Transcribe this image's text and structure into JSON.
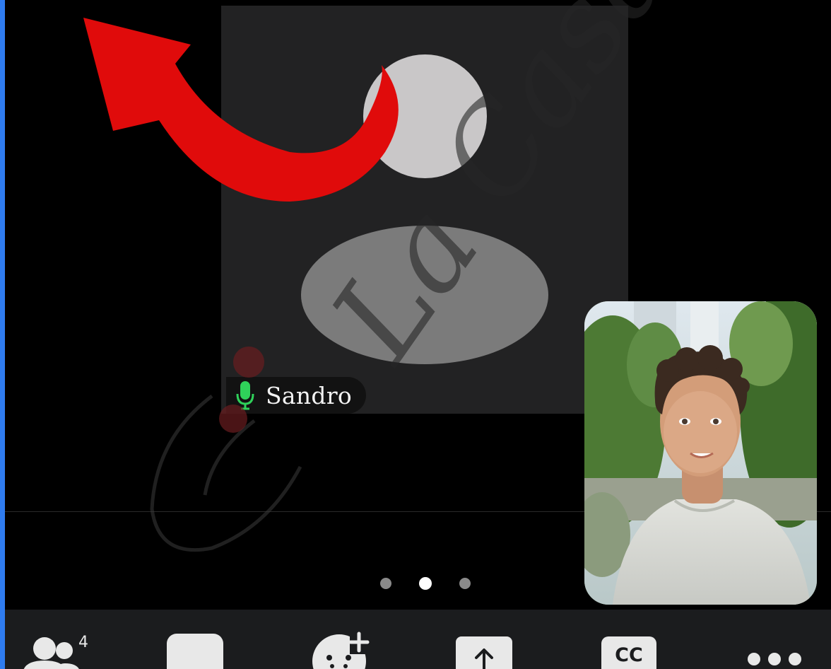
{
  "participant": {
    "name": "Sandro",
    "mic_state": "unmuted",
    "avatar": "default-person-placeholder"
  },
  "pager": {
    "pages": 3,
    "current": 2
  },
  "self_view": {
    "description": "front camera preview"
  },
  "toolbar": {
    "participants_count": "4",
    "buttons": [
      {
        "icon": "participants-icon"
      },
      {
        "icon": "chat-icon"
      },
      {
        "icon": "reactions-icon"
      },
      {
        "icon": "share-icon"
      },
      {
        "icon": "cc-icon",
        "text": "CC"
      },
      {
        "icon": "more-icon"
      }
    ]
  },
  "colors": {
    "accent_edge": "#2f7cf0",
    "mic_active": "#2fd15a",
    "annotation_arrow": "#e00b0b"
  },
  "annotation": {
    "type": "curved-arrow",
    "points_to": "top-left"
  },
  "watermark": {
    "text": "La Casa"
  }
}
